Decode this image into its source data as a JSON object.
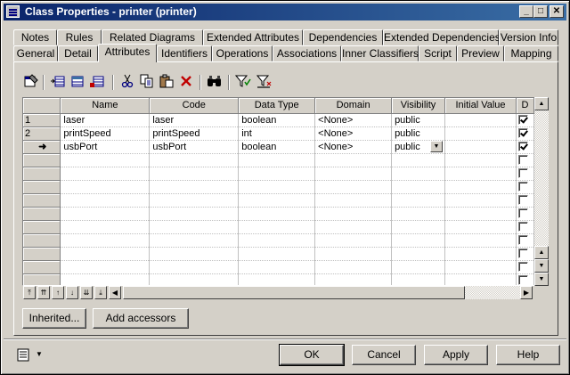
{
  "window": {
    "title": "Class Properties - printer (printer)",
    "controls": {
      "minimize": "_",
      "maximize": "□",
      "close": "✕"
    }
  },
  "tabs": {
    "row_top": [
      "Notes",
      "Rules",
      "Related Diagrams",
      "Extended Attributes",
      "Dependencies",
      "Extended Dependencies",
      "Version Info"
    ],
    "row_bottom": [
      "General",
      "Detail",
      "Attributes",
      "Identifiers",
      "Operations",
      "Associations",
      "Inner Classifiers",
      "Script",
      "Preview",
      "Mapping"
    ],
    "active": "Attributes"
  },
  "toolbar": {
    "icons": [
      "properties-icon",
      "insert-row-icon",
      "add-row-icon",
      "add-attributes-icon",
      "cut-icon",
      "copy-icon",
      "paste-icon",
      "delete-icon",
      "find-icon",
      "filter-icon",
      "filter-clear-icon"
    ]
  },
  "grid": {
    "columns": [
      "Name",
      "Code",
      "Data Type",
      "Domain",
      "Visibility",
      "Initial Value",
      "D"
    ],
    "rows": [
      {
        "marker": "1",
        "name": "laser",
        "code": "laser",
        "data_type": "boolean",
        "domain": "<None>",
        "visibility": "public",
        "initial_value": "",
        "d": true
      },
      {
        "marker": "2",
        "name": "printSpeed",
        "code": "printSpeed",
        "data_type": "int",
        "domain": "<None>",
        "visibility": "public",
        "initial_value": "",
        "d": true
      },
      {
        "marker": "➜",
        "name": "usbPort",
        "code": "usbPort",
        "data_type": "boolean",
        "domain": "<None>",
        "visibility": "public",
        "initial_value": "",
        "d": true
      }
    ],
    "empty_rows": 10
  },
  "nav_buttons": [
    "⤒",
    "⇈",
    "↑",
    "↓",
    "⇊",
    "⤓"
  ],
  "buttons": {
    "inherited": "Inherited...",
    "add_accessors": "Add accessors",
    "ok": "OK",
    "cancel": "Cancel",
    "apply": "Apply",
    "help": "Help"
  }
}
